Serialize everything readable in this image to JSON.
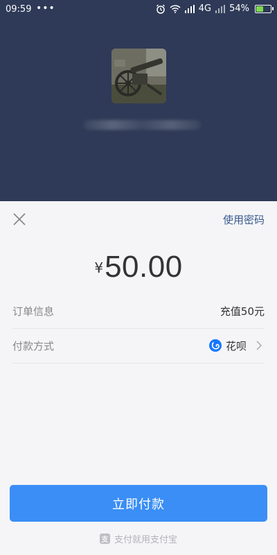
{
  "status_bar": {
    "time": "09:59",
    "dots": "•••",
    "network": "4G",
    "battery": "54%",
    "battery_level": 0.54,
    "battery_color": "#7fd94d"
  },
  "header": {
    "background": "#2e3a57",
    "avatar_icon": "merchant-avatar-image",
    "merchant_name": ""
  },
  "sheet": {
    "close_icon": "close-icon",
    "use_password": "使用密码",
    "currency": "¥",
    "amount": "50.00",
    "order_info": {
      "label": "订单信息",
      "value": "充值50元"
    },
    "payment_method": {
      "label": "付款方式",
      "value": "花呗",
      "icon": "huabei-icon"
    },
    "pay_button": "立即付款",
    "accent": "#3a8ef5",
    "footer": "支付就用支付宝"
  }
}
